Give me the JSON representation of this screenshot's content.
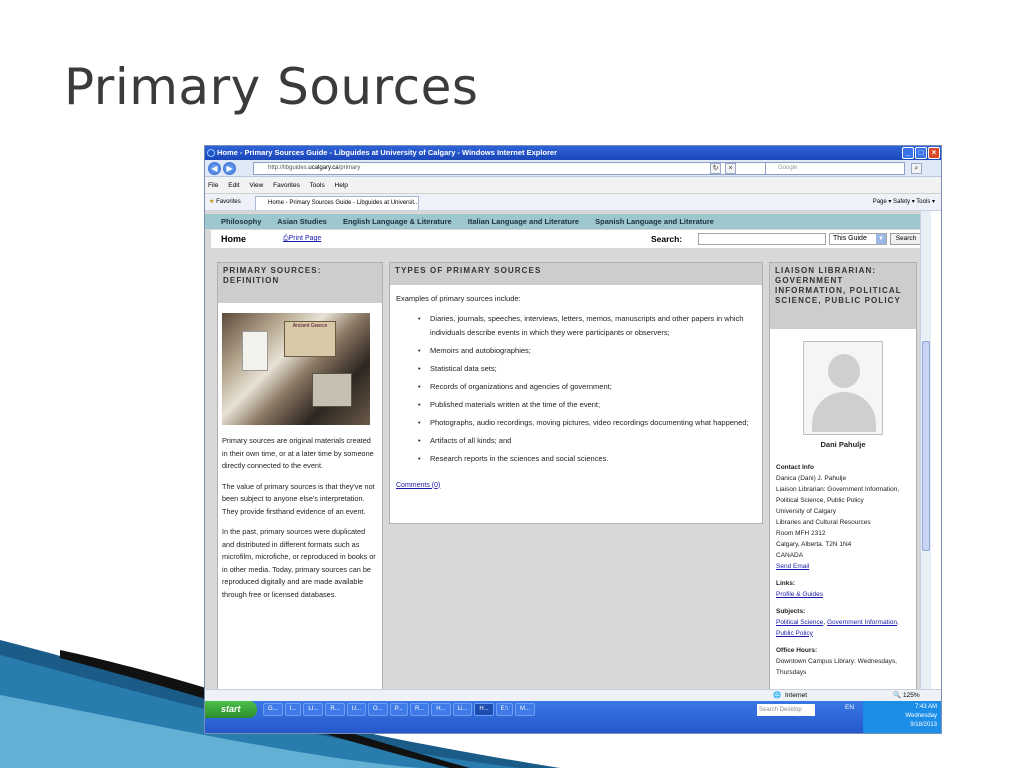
{
  "slide": {
    "title": "Primary Sources"
  },
  "window": {
    "title": "Home - Primary Sources Guide - Libguides at University of Calgary - Windows Internet Explorer",
    "url_prefix": "http://libguides.",
    "url_domain": "ucalgary.ca",
    "url_suffix": "/primary",
    "search_placeholder": "Google",
    "menu": [
      "File",
      "Edit",
      "View",
      "Favorites",
      "Tools",
      "Help"
    ],
    "favorites_label": "Favorites",
    "tab_label": "Home - Primary Sources Guide - Libguides at Universit...",
    "toolbar_right": "Page ▾  Safety ▾  Tools ▾"
  },
  "nav": {
    "subjects": [
      "Philosophy",
      "Asian Studies",
      "English Language & Literature",
      "Italian Language and Literature",
      "Spanish Language and Literature"
    ],
    "home": "Home",
    "print": "Print Page",
    "search_label": "Search:",
    "scope": "This Guide",
    "search_btn": "Search"
  },
  "definition": {
    "heading": "PRIMARY SOURCES: DEFINITION",
    "photo_caption": "Ancient Greece",
    "paragraphs": [
      "Primary sources are original materials created in their own time, or at a later time by someone directly connected to the event.",
      "The value of primary sources is that they've not been subject to anyone else's interpretation. They provide firsthand evidence of an event.",
      "In the past, primary sources were duplicated and distributed in different formats such as microfilm, microfiche, or reproduced in books or in other media. Today, primary sources can be reproduced digitally and are made available through free or licensed databases."
    ]
  },
  "types": {
    "heading": "TYPES OF PRIMARY SOURCES",
    "intro": "Examples of primary sources include:",
    "items": [
      "Diaries, journals, speeches, interviews, letters, memos, manuscripts and other papers in which individuals describe events in which they were participants or observers;",
      "Memoirs and autobiographies;",
      "Statistical data sets;",
      "Records of organizations and agencies of government;",
      "Published materials written at the time of the event;",
      "Photographs, audio recordings, moving pictures, video recordings documenting what happened;",
      "Artifacts of all kinds; and",
      "Research reports in the sciences and social sciences."
    ],
    "comments": "Comments (0)"
  },
  "librarian": {
    "heading": "LIAISON LIBRARIAN: GOVERNMENT INFORMATION, POLITICAL SCIENCE, PUBLIC POLICY",
    "name": "Dani Pahulje",
    "contact_label": "Contact Info",
    "contact_lines": [
      "Danica (Dani) J. Pahulje",
      "Liaison Librarian: Government Information, Political Science, Public Policy",
      "University of Calgary",
      "Libraries and Cultural Resources",
      "Room MFH 2312",
      "Calgary, Alberta. T2N 1N4",
      "CANADA"
    ],
    "send_email": "Send Email",
    "links_label": "Links:",
    "links": "Profile & Guides",
    "subjects_label": "Subjects:",
    "subjects": [
      "Political Science",
      "Government Information",
      "Public Policy"
    ],
    "hours_label": "Office Hours:",
    "hours": "Downtown Campus Library: Wednesdays, Thursdays"
  },
  "status": {
    "zone": "Internet",
    "zoom": "125%"
  },
  "taskbar": {
    "start": "start",
    "items": [
      "G...",
      "I...",
      "LI...",
      "R...",
      "U...",
      "O...",
      "P...",
      "R...",
      "H...",
      "Li...",
      "H...",
      "E:\\",
      "M..."
    ],
    "search": "Search Desktop",
    "lang": "EN",
    "time": "7:43 AM",
    "day": "Wednesday",
    "date": "9/18/2013"
  }
}
